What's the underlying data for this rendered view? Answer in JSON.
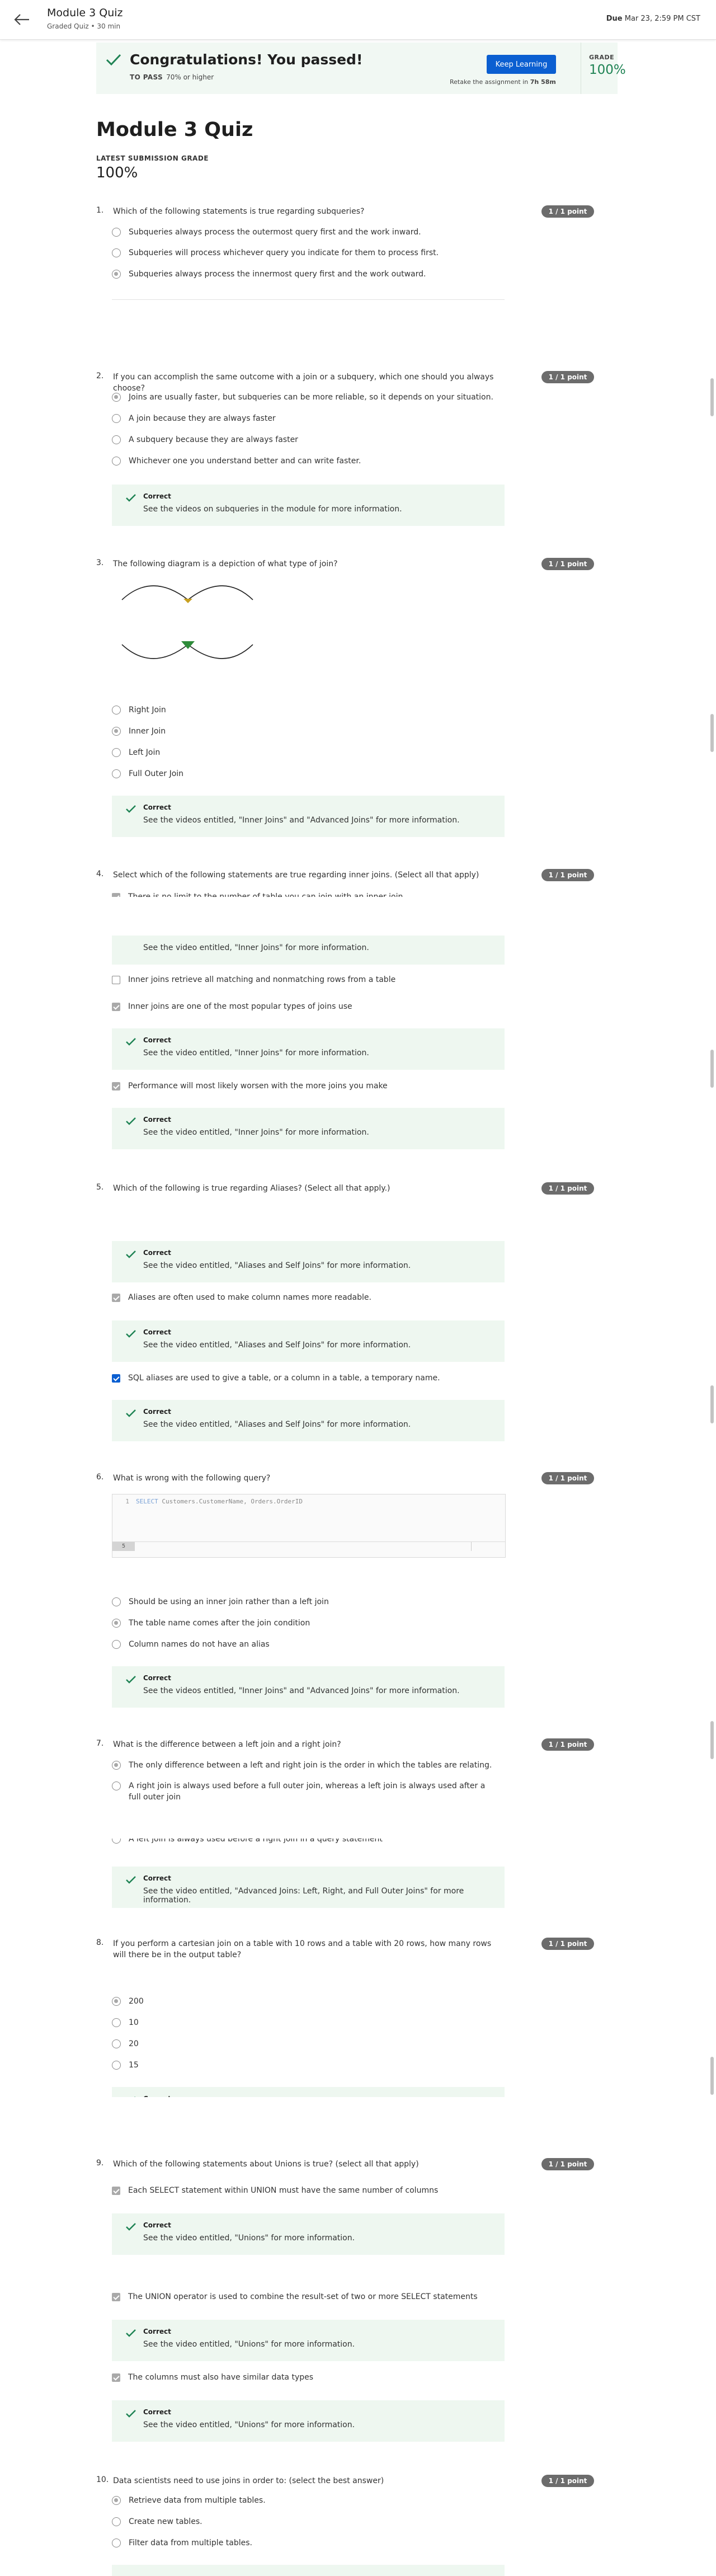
{
  "header": {
    "title": "Module 3 Quiz",
    "subtitle": "Graded Quiz • 30 min",
    "due_label": "Due",
    "due_value": "Mar 23, 2:59 PM CST"
  },
  "banner": {
    "title": "Congratulations! You passed!",
    "to_pass_label": "TO PASS",
    "to_pass_value": "70% or higher",
    "keep_learning": "Keep Learning",
    "retake_text": "Retake the assignment in",
    "retake_time": "7h 58m",
    "grade_label": "GRADE",
    "grade_value": "100%"
  },
  "quiz": {
    "title": "Module 3 Quiz",
    "latest_label": "LATEST SUBMISSION GRADE",
    "latest_value": "100%"
  },
  "points": "1 / 1 point",
  "correct": "Correct",
  "questions": [
    {
      "num": "1.",
      "text": "Which of the following statements is true regarding subqueries?",
      "options": [
        "Subqueries always process the outermost query first and the work inward.",
        "Subqueries will process whichever query you indicate for them to process first.",
        "Subqueries always process the innermost query first and the work outward."
      ]
    },
    {
      "num": "2.",
      "text": "If you can accomplish the same outcome with a join or a subquery, which one should you always choose?",
      "options": [
        "Joins are usually faster, but subqueries can be more reliable, so it depends on your situation.",
        "A join because they are always faster",
        "A subquery because they are always faster",
        "Whichever one you understand better and can write faster."
      ],
      "feedback": "See the videos on subqueries in the module for more information."
    },
    {
      "num": "3.",
      "text": "The following diagram is a depiction of what type of join?",
      "options": [
        "Right Join",
        "Inner Join",
        "Left Join",
        "Full Outer Join"
      ],
      "feedback": "See the videos entitled, \"Inner Joins\" and \"Advanced Joins\" for more information."
    },
    {
      "num": "4.",
      "text": "Select which of the following statements are true regarding inner joins. (Select all that apply)",
      "partial": "There is no limit to the number of table you can join with an inner join.",
      "feedback_a": "See the video entitled, \"Inner Joins\" for more information.",
      "options": [
        "Inner joins retrieve all matching and nonmatching rows from a table",
        "Inner joins are one of the most popular types of joins use",
        "Performance will most likely worsen with the more joins you make"
      ],
      "feedback_b": "See the video entitled, \"Inner Joins\" for more information.",
      "feedback_c": "See the video entitled, \"Inner Joins\" for more information."
    },
    {
      "num": "5.",
      "text": "Which of the following is true regarding Aliases? (Select all that apply.)",
      "feedback_a": "See the video entitled, \"Aliases and Self Joins\" for more information.",
      "options": [
        "Aliases are often used to make column names more readable.",
        "SQL aliases are used to give a table, or a column in a table, a temporary name."
      ],
      "feedback_b": "See the video entitled, \"Aliases and Self Joins\" for more information.",
      "feedback_c": "See the video entitled, \"Aliases and Self Joins\" for more information."
    },
    {
      "num": "6.",
      "text": "What is wrong with the following query?",
      "code_line_no": "1",
      "code_kw": "SELECT",
      "code_rest": "Customers.CustomerName, Orders.OrderID",
      "code_footer_no": "5",
      "options": [
        "Should be using an inner join rather than a left join",
        "The table name comes after the join condition",
        "Column names do not have an alias"
      ],
      "feedback": "See the videos entitled, \"Inner Joins\" and \"Advanced Joins\" for more information."
    },
    {
      "num": "7.",
      "text": "What is the difference between a left join and a right join?",
      "options": [
        "The only difference between a left and right join is the order in which the tables are relating.",
        "A right join is always used before a full outer join, whereas a left join is always used after a full outer join",
        "A left join is always used before a right join in a query statement"
      ],
      "feedback": "See the video entitled, \"Advanced Joins: Left, Right, and Full Outer Joins\" for more information."
    },
    {
      "num": "8.",
      "text": "If you perform a cartesian join on a table with 10 rows and a table with 20 rows, how many rows will there be in the output table?",
      "options": [
        "200",
        "10",
        "20",
        "15"
      ]
    },
    {
      "num": "9.",
      "text": "Which of the following statements about Unions is true? (select all that apply)",
      "options": [
        "Each SELECT statement within UNION must have the same number of columns",
        "The UNION operator is used to combine the result-set of two or more SELECT statements",
        "The columns must also have similar data types"
      ],
      "feedback_a": "See the video entitled, \"Unions\" for more information.",
      "feedback_b": "See the video entitled, \"Unions\" for more information.",
      "feedback_c": "See the video entitled, \"Unions\" for more information."
    },
    {
      "num": "10.",
      "text": "Data scientists need to use joins in order to: (select the best answer)",
      "options": [
        "Retrieve data from multiple tables.",
        "Create new tables.",
        "Filter data from multiple tables."
      ]
    }
  ],
  "colors": {
    "accent": "#0b5fd1",
    "success": "#1f8354",
    "feedback_bg": "#eef7f0",
    "banner_bg": "#f1f8f3",
    "points_badge": "#6c6c6c"
  },
  "icons": [
    "back-arrow-icon",
    "check-icon",
    "radio-icon",
    "checkbox-icon"
  ]
}
